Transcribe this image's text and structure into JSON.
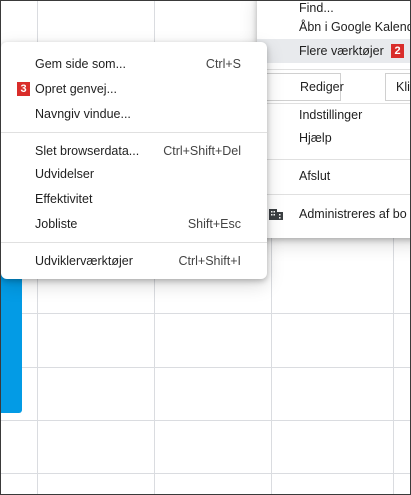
{
  "main_menu": {
    "find": "Find...",
    "open_google_calendar": "Åbn i Google Kalender",
    "more_tools": "Flere værktøjer",
    "more_tools_badge": "2",
    "edit": "Rediger",
    "cut": "Klip",
    "settings": "Indstillinger",
    "help": "Hjælp",
    "exit": "Afslut",
    "managed": "Administreres af bo",
    "managed_icon": "building-icon"
  },
  "sub_menu": {
    "items": [
      {
        "label": "Gem side som...",
        "shortcut": "Ctrl+S"
      },
      {
        "label": "Opret genvej...",
        "shortcut": "",
        "badge": "3"
      },
      {
        "label": "Navngiv vindue...",
        "shortcut": ""
      },
      {
        "label": "Slet browserdata...",
        "shortcut": "Ctrl+Shift+Del"
      },
      {
        "label": "Udvidelser",
        "shortcut": ""
      },
      {
        "label": "Effektivitet",
        "shortcut": ""
      },
      {
        "label": "Jobliste",
        "shortcut": "Shift+Esc"
      },
      {
        "label": "Udviklerværktøjer",
        "shortcut": "Ctrl+Shift+I"
      }
    ]
  },
  "colors": {
    "badge": "#d92d2a",
    "event_bar": "#039be5",
    "highlight": "#e8eaed"
  }
}
